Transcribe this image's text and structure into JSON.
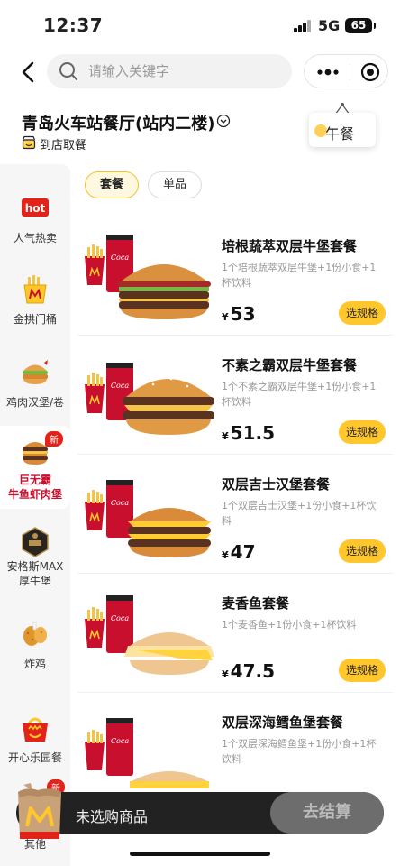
{
  "status_bar": {
    "time": "12:37",
    "network": "5G",
    "battery": "65"
  },
  "search": {
    "placeholder": "请输入关键字",
    "value": ""
  },
  "store": {
    "name": "青岛火车站餐厅(站内二楼)",
    "pickup": "到店取餐",
    "meal_period": "午餐"
  },
  "tabs": [
    {
      "label": "套餐",
      "active": true
    },
    {
      "label": "单品",
      "active": false
    }
  ],
  "sidebar": {
    "items": [
      {
        "icon": "hot-tag-icon",
        "label": "人气热卖",
        "hot_text": "hot"
      },
      {
        "icon": "fries-bucket-icon",
        "label": "金拱门桶"
      },
      {
        "icon": "chicken-burger-icon",
        "label": "鸡肉汉堡/卷"
      },
      {
        "icon": "big-mac-icon",
        "label": "巨无霸\n牛鱼虾肉堡",
        "badge": "新",
        "active": true
      },
      {
        "icon": "angus-badge-icon",
        "label": "安格斯MAX\n厚牛堡"
      },
      {
        "icon": "fried-chicken-icon",
        "label": "炸鸡"
      },
      {
        "icon": "happy-meal-icon",
        "label": "开心乐园餐"
      },
      {
        "icon": "other-icon",
        "label": "其他",
        "badge": "新"
      }
    ]
  },
  "products": [
    {
      "name": "培根蔬萃双层牛堡套餐",
      "desc": "1个培根蔬萃双层牛堡+1份小食+1杯饮料",
      "price": "53",
      "button": "选规格",
      "burger": "bacon"
    },
    {
      "name": "不素之霸双层牛堡套餐",
      "desc": "1个不素之霸双层牛堡+1份小食+1杯饮料",
      "price": "51.5",
      "button": "选规格",
      "burger": "double"
    },
    {
      "name": "双层吉士汉堡套餐",
      "desc": "1个双层吉士汉堡+1份小食+1杯饮料",
      "price": "47",
      "button": "选规格",
      "burger": "cheese"
    },
    {
      "name": "麦香鱼套餐",
      "desc": "1个麦香鱼+1份小食+1杯饮料",
      "price": "47.5",
      "button": "选规格",
      "burger": "fish"
    },
    {
      "name": "双层深海鳕鱼堡套餐",
      "desc": "1个双层深海鳕鱼堡+1份小食+1杯饮料",
      "price": "",
      "button": "",
      "burger": "fish2"
    }
  ],
  "currency": "¥",
  "cart": {
    "empty_label": "未选购商品",
    "checkout_label": "去结算"
  },
  "colors": {
    "brand_red": "#c8102e",
    "brand_yellow": "#ffc72c",
    "cart_bar": "#222222"
  }
}
